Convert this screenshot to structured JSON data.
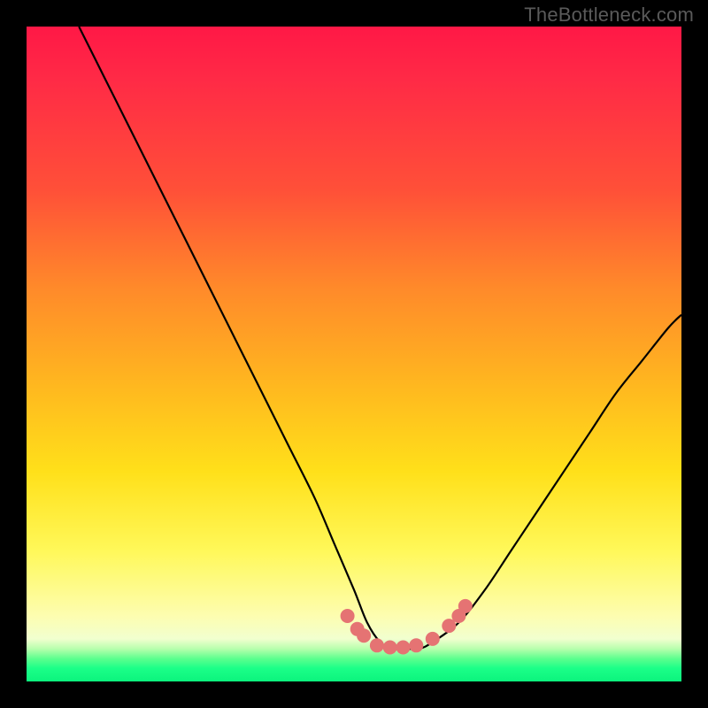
{
  "watermark": "TheBottleneck.com",
  "chart_data": {
    "type": "line",
    "title": "",
    "xlabel": "",
    "ylabel": "",
    "xlim": [
      0,
      100
    ],
    "ylim": [
      0,
      100
    ],
    "grid": false,
    "legend": false,
    "series": [
      {
        "name": "bottleneck-curve",
        "color": "#000000",
        "x": [
          8,
          12,
          16,
          20,
          24,
          28,
          32,
          36,
          40,
          44,
          47,
          50,
          52,
          54,
          56,
          58,
          60,
          62,
          66,
          70,
          74,
          78,
          82,
          86,
          90,
          94,
          98,
          100
        ],
        "values": [
          100,
          92,
          84,
          76,
          68,
          60,
          52,
          44,
          36,
          28,
          21,
          14,
          9,
          6,
          5,
          5,
          5,
          6,
          9,
          14,
          20,
          26,
          32,
          38,
          44,
          49,
          54,
          56
        ]
      }
    ],
    "markers": [
      {
        "name": "left-cluster-1",
        "x": 49.0,
        "y": 10.0,
        "color": "#e57373"
      },
      {
        "name": "left-cluster-2",
        "x": 50.5,
        "y": 8.0,
        "color": "#e57373"
      },
      {
        "name": "left-cluster-3",
        "x": 51.5,
        "y": 7.0,
        "color": "#e57373"
      },
      {
        "name": "flat-1",
        "x": 53.5,
        "y": 5.5,
        "color": "#e57373"
      },
      {
        "name": "flat-2",
        "x": 55.5,
        "y": 5.2,
        "color": "#e57373"
      },
      {
        "name": "flat-3",
        "x": 57.5,
        "y": 5.2,
        "color": "#e57373"
      },
      {
        "name": "flat-4",
        "x": 59.5,
        "y": 5.5,
        "color": "#e57373"
      },
      {
        "name": "right-gap-1",
        "x": 62.0,
        "y": 6.5,
        "color": "#e57373"
      },
      {
        "name": "right-cluster-1",
        "x": 64.5,
        "y": 8.5,
        "color": "#e57373"
      },
      {
        "name": "right-cluster-2",
        "x": 66.0,
        "y": 10.0,
        "color": "#e57373"
      },
      {
        "name": "right-cluster-3",
        "x": 67.0,
        "y": 11.5,
        "color": "#e57373"
      }
    ],
    "background": {
      "type": "vertical-gradient",
      "stops": [
        {
          "pos": 0.0,
          "color": "#ff1846"
        },
        {
          "pos": 0.4,
          "color": "#ff8a2a"
        },
        {
          "pos": 0.68,
          "color": "#ffe01a"
        },
        {
          "pos": 0.9,
          "color": "#fdfdb0"
        },
        {
          "pos": 0.96,
          "color": "#5dff8e"
        },
        {
          "pos": 1.0,
          "color": "#0cf47d"
        }
      ]
    }
  }
}
